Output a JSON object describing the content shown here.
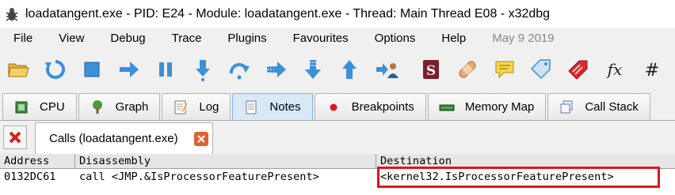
{
  "window": {
    "title": "loadatangent.exe - PID: E24 - Module: loadatangent.exe - Thread: Main Thread E08 - x32dbg",
    "icon": "bug-icon"
  },
  "menu": {
    "items": [
      "File",
      "View",
      "Debug",
      "Trace",
      "Plugins",
      "Favourites",
      "Options",
      "Help"
    ],
    "date": "May 9 2019"
  },
  "toolbar": {
    "buttons": [
      "open-icon",
      "restart-icon",
      "stop-icon",
      "run-icon",
      "pause-icon",
      "step-into-icon",
      "step-over-icon",
      "animate-into-icon",
      "animate-over-icon",
      "execute-till-return-icon",
      "run-to-user-code-icon",
      "scylla-icon",
      "patch-icon",
      "comment-icon",
      "label-icon",
      "bookmark-icon",
      "function-icon",
      "hash-icon"
    ]
  },
  "tabs": [
    {
      "label": "CPU",
      "icon": "cpu-icon"
    },
    {
      "label": "Graph",
      "icon": "graph-icon"
    },
    {
      "label": "Log",
      "icon": "log-icon"
    },
    {
      "label": "Notes",
      "icon": "notes-icon",
      "active": true
    },
    {
      "label": "Breakpoints",
      "icon": "breakpoint-icon"
    },
    {
      "label": "Memory Map",
      "icon": "memory-map-icon"
    },
    {
      "label": "Call Stack",
      "icon": "call-stack-icon"
    }
  ],
  "references": {
    "tab_label": "Calls (loadatangent.exe)"
  },
  "table": {
    "columns": [
      "Address",
      "Disassembly",
      "Destination"
    ],
    "rows": [
      {
        "address": "0132DC61",
        "disassembly": "call <JMP.&IsProcessorFeaturePresent>",
        "destination": "<kernel32.IsProcessorFeaturePresent>"
      }
    ]
  },
  "colors": {
    "highlight_border": "#e0141e",
    "active_tab": "#d9e8f7"
  }
}
